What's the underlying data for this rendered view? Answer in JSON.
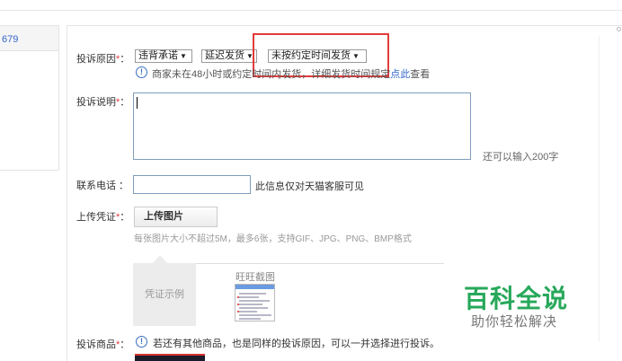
{
  "sidebar": {
    "order_fragment": "679"
  },
  "form": {
    "reason": {
      "label": "投诉原因",
      "required_mark": "*",
      "colon": "：",
      "selects": [
        {
          "value": "违背承诺"
        },
        {
          "value": "延迟发货"
        },
        {
          "value": "未按约定时间发货"
        }
      ],
      "hint_before_link": "商家未在48小时或约定时间内发货，详细发货时间规定",
      "hint_link": "点此",
      "hint_after_link": "查看"
    },
    "description": {
      "label": "投诉说明",
      "required_mark": "*",
      "colon": "：",
      "value": "",
      "remaining_text": "还可以输入200字"
    },
    "phone": {
      "label": "联系电话 ：",
      "value": "",
      "note": "此信息仅对天猫客服可见"
    },
    "evidence": {
      "label": "上传凭证",
      "required_mark": "*",
      "colon": "：",
      "upload_button": "上传图片",
      "upload_hint": "每张图片大小不超过5M，最多6张，支持GIF、JPG、PNG、BMP格式",
      "sample_tab": "凭证示例",
      "sample_caption": "旺旺截图"
    },
    "products": {
      "label": "投诉商品",
      "required_mark": "*",
      "colon": "：",
      "hint": "若还有其他商品，也是同样的投诉原因，可以一并选择进行投诉。"
    }
  },
  "watermark": {
    "title": "百科全说",
    "subtitle": "助你轻松解决"
  },
  "colors": {
    "required": "#e4393c",
    "link": "#3366cc",
    "highlight": "#e23b3b",
    "watermark": "#27a85a"
  }
}
